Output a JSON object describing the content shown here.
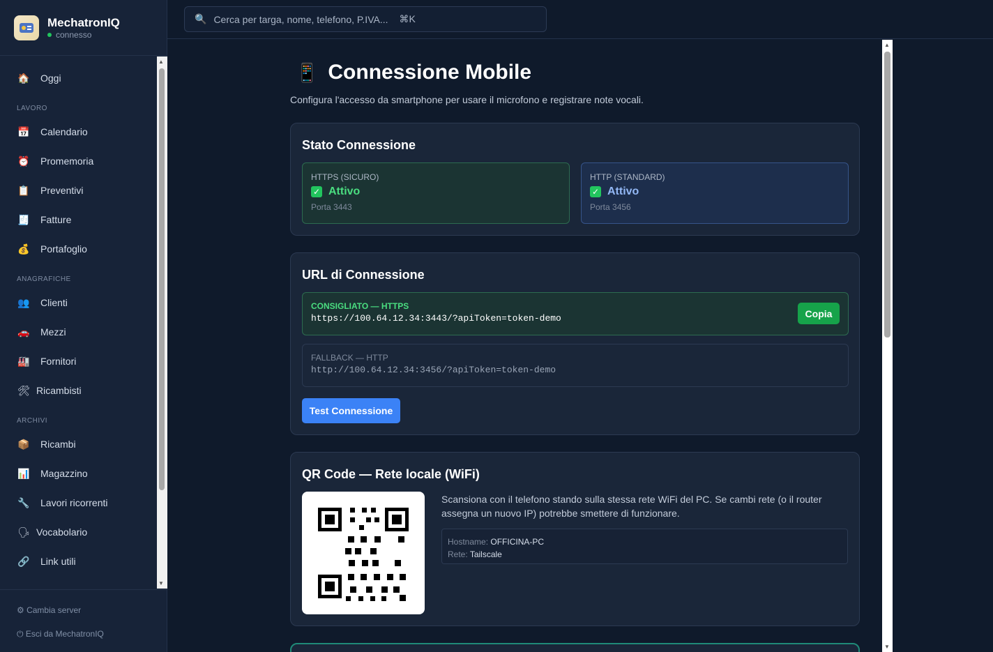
{
  "app": {
    "name": "MechatronIQ",
    "status": "connesso",
    "logo_icon": "car-wrench-logo"
  },
  "search": {
    "placeholder": "Cerca per targa, nome, telefono, P.IVA...",
    "shortcut": "⌘K"
  },
  "sidebar": {
    "top_item": {
      "label": "Oggi",
      "icon": "🏠"
    },
    "sections": [
      {
        "label": "LAVORO",
        "items": [
          {
            "label": "Calendario",
            "icon": "📅"
          },
          {
            "label": "Promemoria",
            "icon": "⏰"
          },
          {
            "label": "Preventivi",
            "icon": "📋"
          },
          {
            "label": "Fatture",
            "icon": "🧾"
          },
          {
            "label": "Portafoglio",
            "icon": "💰"
          }
        ]
      },
      {
        "label": "ANAGRAFICHE",
        "items": [
          {
            "label": "Clienti",
            "icon": "👥"
          },
          {
            "label": "Mezzi",
            "icon": "🚗"
          },
          {
            "label": "Fornitori",
            "icon": "🏭"
          },
          {
            "label": "Ricambisti",
            "icon": "🛠"
          }
        ]
      },
      {
        "label": "ARCHIVI",
        "items": [
          {
            "label": "Ricambi",
            "icon": "📦"
          },
          {
            "label": "Magazzino",
            "icon": "📊"
          },
          {
            "label": "Lavori ricorrenti",
            "icon": "🔧"
          },
          {
            "label": "Vocabolario",
            "icon": "🗣"
          },
          {
            "label": "Link utili",
            "icon": "🔗"
          }
        ]
      }
    ],
    "footer": {
      "change_server": "⚙ Cambia server",
      "logout": "⏻ Esci da MechatronIQ"
    }
  },
  "page": {
    "title": "Connessione Mobile",
    "title_icon": "📱",
    "subtitle": "Configura l'accesso da smartphone per usare il microfono e registrare note vocali."
  },
  "status_card": {
    "title": "Stato Connessione",
    "https": {
      "label": "HTTPS (SICURO)",
      "value": "Attivo",
      "port": "Porta 3443"
    },
    "http": {
      "label": "HTTP (STANDARD)",
      "value": "Attivo",
      "port": "Porta 3456"
    },
    "check_icon": "✓"
  },
  "url_card": {
    "title": "URL di Connessione",
    "primary": {
      "label": "CONSIGLIATO — HTTPS",
      "url": "https://100.64.12.34:3443/?apiToken=token-demo",
      "copy_label": "Copia"
    },
    "fallback": {
      "label": "FALLBACK — HTTP",
      "url": "http://100.64.12.34:3456/?apiToken=token-demo"
    },
    "test_label": "Test Connessione"
  },
  "qr_card": {
    "title": "QR Code — Rete locale (WiFi)",
    "description": "Scansiona con il telefono stando sulla stessa rete WiFi del PC. Se cambi rete (o il router assegna un nuovo IP) potrebbe smettere di funzionare.",
    "hostname_key": "Hostname:",
    "hostname_value": "OFFICINA-PC",
    "network_key": "Rete:",
    "network_value": "Tailscale"
  },
  "colors": {
    "background": "#0f1a2b",
    "accent_green": "#16a34a",
    "accent_blue": "#3b82f6",
    "status_green": "#4ade80"
  }
}
